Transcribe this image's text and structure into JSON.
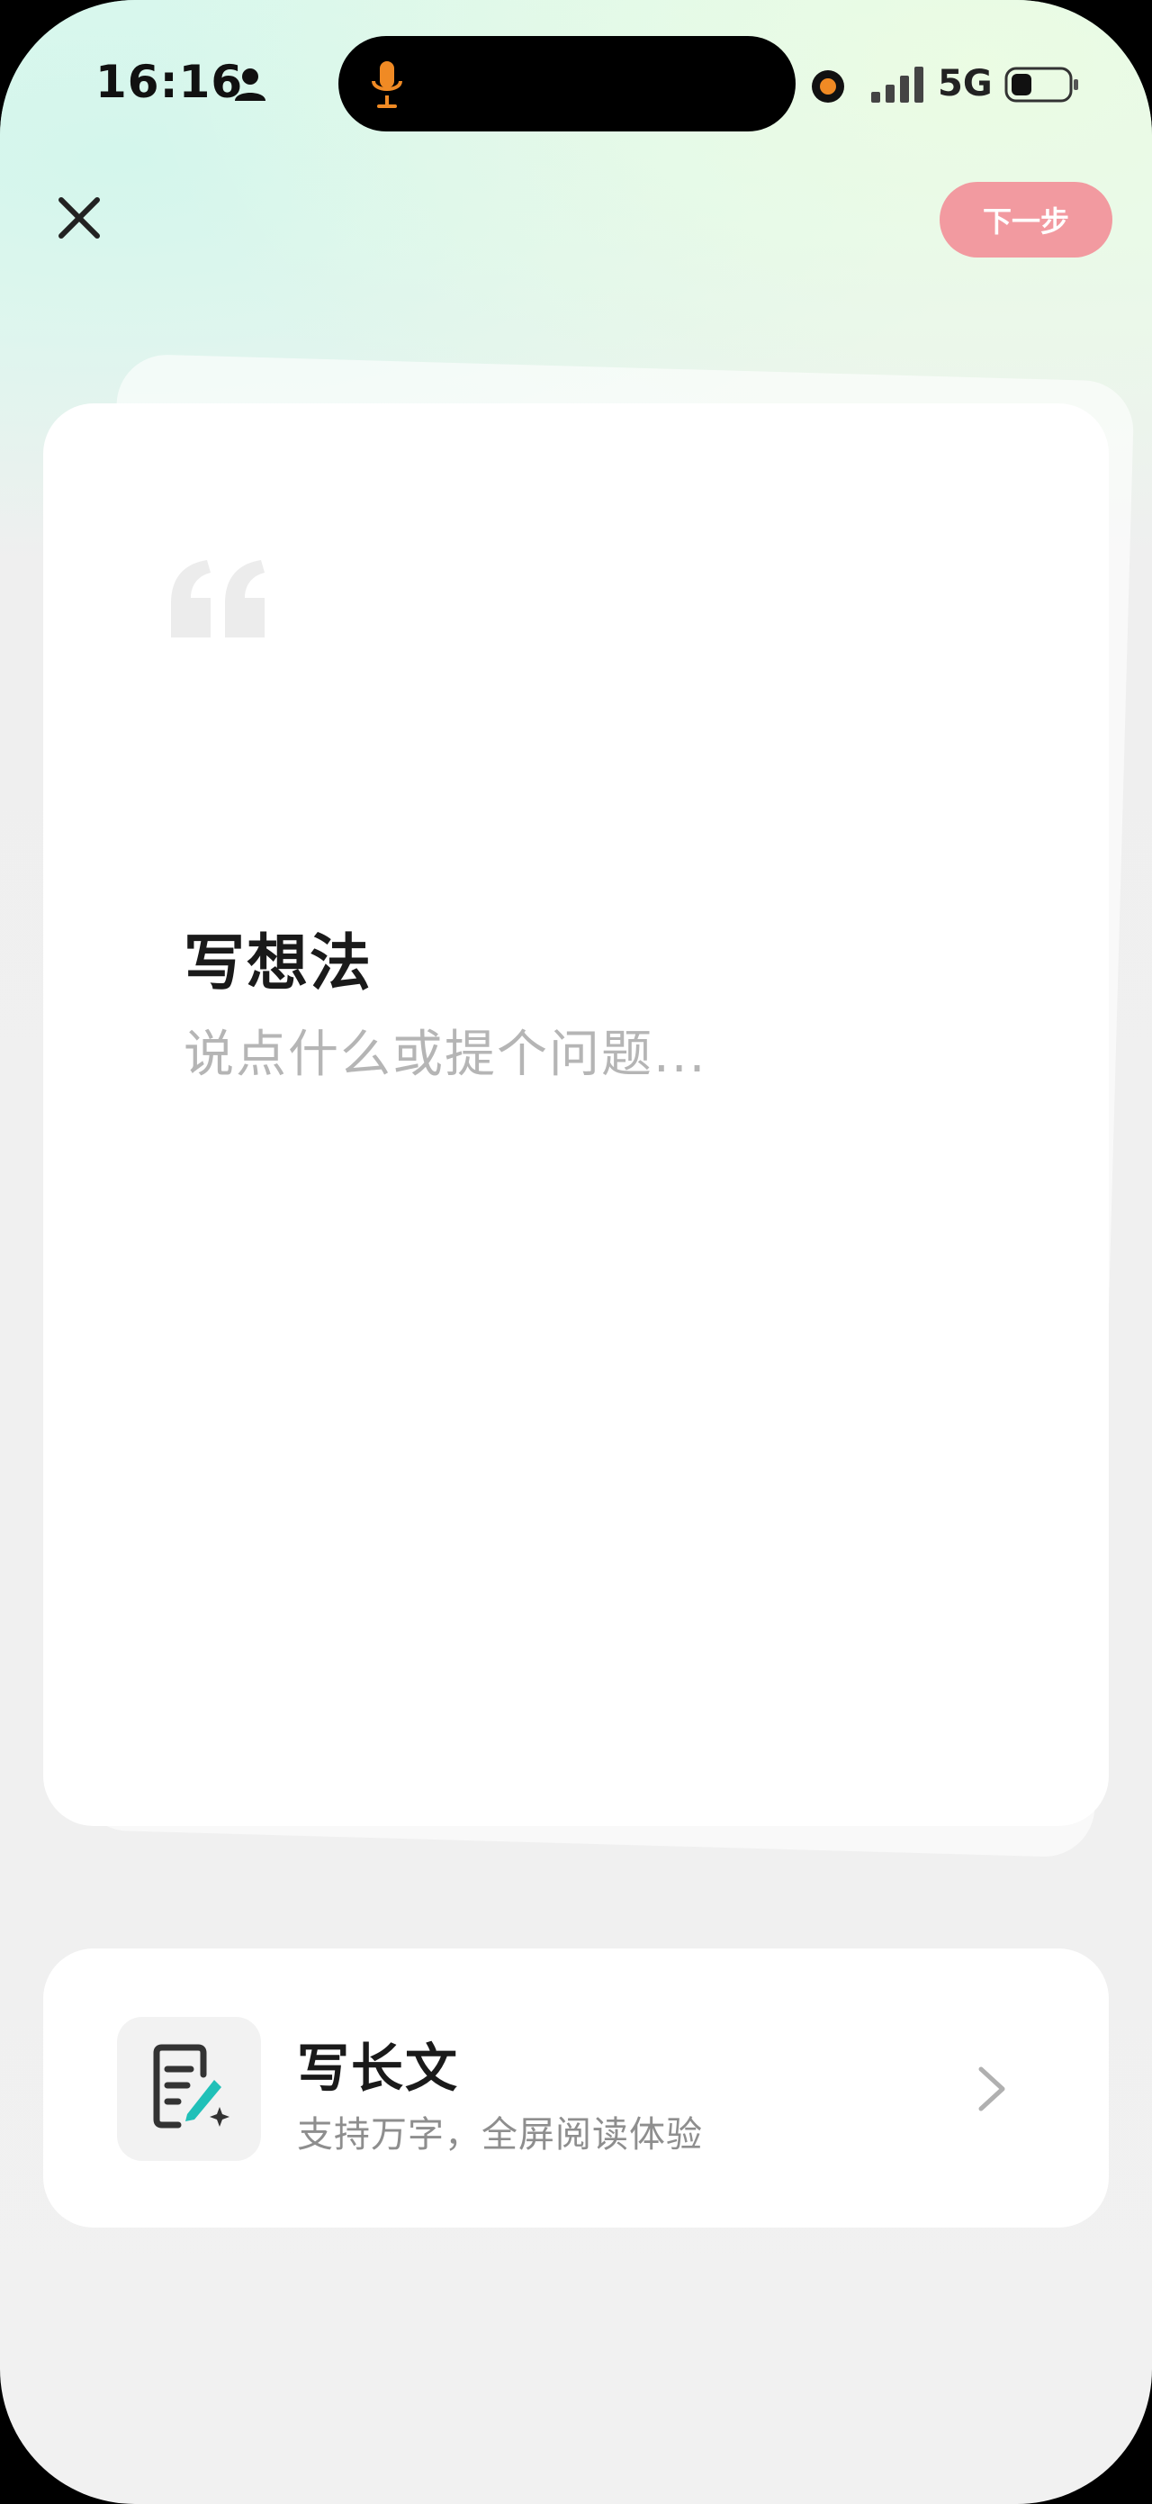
{
  "status_bar": {
    "time": "16:16",
    "network": "5G"
  },
  "header": {
    "next_label": "下一步"
  },
  "composer": {
    "title": "写想法",
    "placeholder": "说点什么或提个问题..."
  },
  "long_article": {
    "title": "写长文",
    "subtitle": "支持万字，全屏阅读体验"
  },
  "colors": {
    "accent_button": "#f29aa0",
    "mic_orange": "#f08a24",
    "icon_teal": "#20c0b8"
  },
  "icons": [
    "person-icon",
    "mic-icon",
    "signal-icon",
    "battery-icon",
    "close-icon",
    "quote-icon",
    "write-document-icon",
    "chevron-right-icon"
  ]
}
